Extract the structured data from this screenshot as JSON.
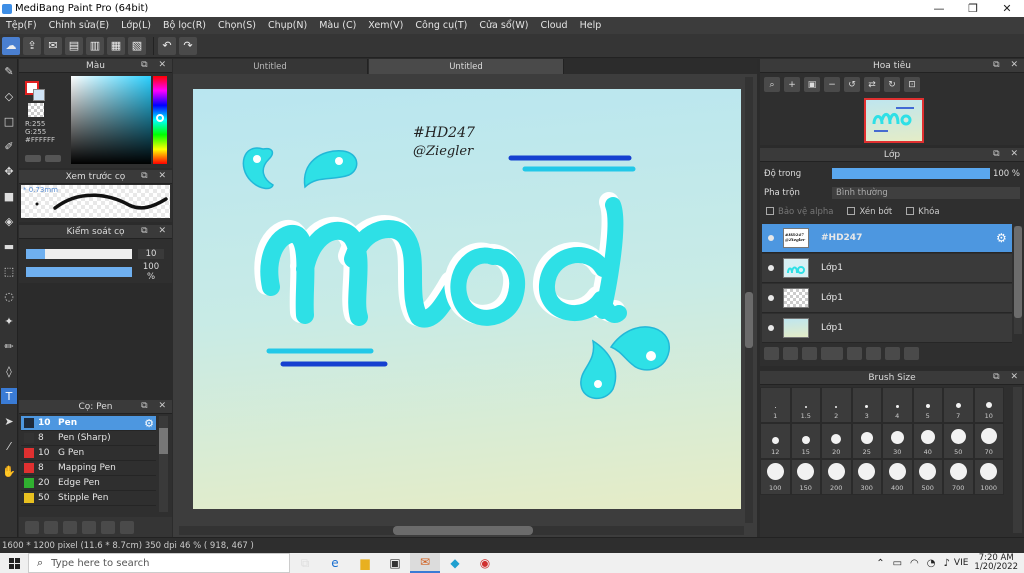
{
  "window": {
    "title": "MediBang Paint Pro (64bit)",
    "minimize": "—",
    "maximize": "❐",
    "close": "✕"
  },
  "menu": [
    "Tệp(F)",
    "Chỉnh sửa(E)",
    "Lớp(L)",
    "Bộ lọc(R)",
    "Chọn(S)",
    "Chụp(N)",
    "Màu (C)",
    "Xem(V)",
    "Công cụ(T)",
    "Cửa sổ(W)",
    "Cloud",
    "Help"
  ],
  "toolbar": {
    "undo": "↶",
    "redo": "↷"
  },
  "color_panel": {
    "title": "Màu",
    "rgb": [
      "R:255",
      "G:255",
      "#FFFFFF"
    ],
    "sv_hue_color": "#2bd0ff"
  },
  "brush_preview": {
    "title": "Xem trước cọ",
    "size": "0.73mm"
  },
  "brush_control": {
    "title": "Kiểm soát cọ",
    "size_value": "10",
    "opacity_value": "100 %",
    "size_level": 0.18,
    "opacity_level": 1.0
  },
  "brush_list": {
    "title": "Cọ: Pen",
    "items": [
      {
        "size": "10",
        "name": "Pen",
        "color": "#1e2a3a",
        "selected": true
      },
      {
        "size": "8",
        "name": "Pen (Sharp)",
        "color": "#333333"
      },
      {
        "size": "10",
        "name": "G Pen",
        "color": "#e03030"
      },
      {
        "size": "8",
        "name": "Mapping Pen",
        "color": "#e03030"
      },
      {
        "size": "20",
        "name": "Edge Pen",
        "color": "#30b030"
      },
      {
        "size": "50",
        "name": "Stipple Pen",
        "color": "#e8c020"
      }
    ]
  },
  "canvas": {
    "tabs": [
      "Untitled",
      "Untitled"
    ],
    "active_tab": 1,
    "art_text_line1": "#HD247",
    "art_text_line2": "@Ziegler",
    "art_colors": {
      "cyan": "#2ee0e6",
      "shadow": "#ffffff",
      "blue": "#1540d0",
      "light_blue": "#22c8e8"
    }
  },
  "navigator": {
    "title": "Hoa tiêu"
  },
  "layer_panel": {
    "title": "Lớp",
    "opacity_label": "Độ trong",
    "opacity_value": "100 %",
    "blend_label": "Pha trộn",
    "blend_value": "Bình thường",
    "protect_alpha": "Bảo vệ alpha",
    "clipping": "Xén bớt",
    "lock": "Khóa",
    "layers": [
      {
        "name": "#HD247",
        "selected": true,
        "thumb_text": "#HD247 @Ziegler"
      },
      {
        "name": "Lớp1"
      },
      {
        "name": "Lớp1"
      },
      {
        "name": "Lớp1"
      }
    ]
  },
  "brush_size_panel": {
    "title": "Brush Size",
    "sizes": [
      "1",
      "1.5",
      "2",
      "3",
      "4",
      "5",
      "7",
      "10",
      "12",
      "15",
      "20",
      "25",
      "30",
      "40",
      "50",
      "70",
      "100",
      "150",
      "200",
      "300",
      "400",
      "500",
      "700",
      "1000"
    ]
  },
  "status": {
    "text": "1600 * 1200 pixel   (11.6 * 8.7cm)   350 dpi   46 %   ( 918, 467 )"
  },
  "taskbar": {
    "search_placeholder": "Type here to search",
    "lang": "VIE",
    "time": "7:20 AM",
    "date": "1/20/2022"
  }
}
